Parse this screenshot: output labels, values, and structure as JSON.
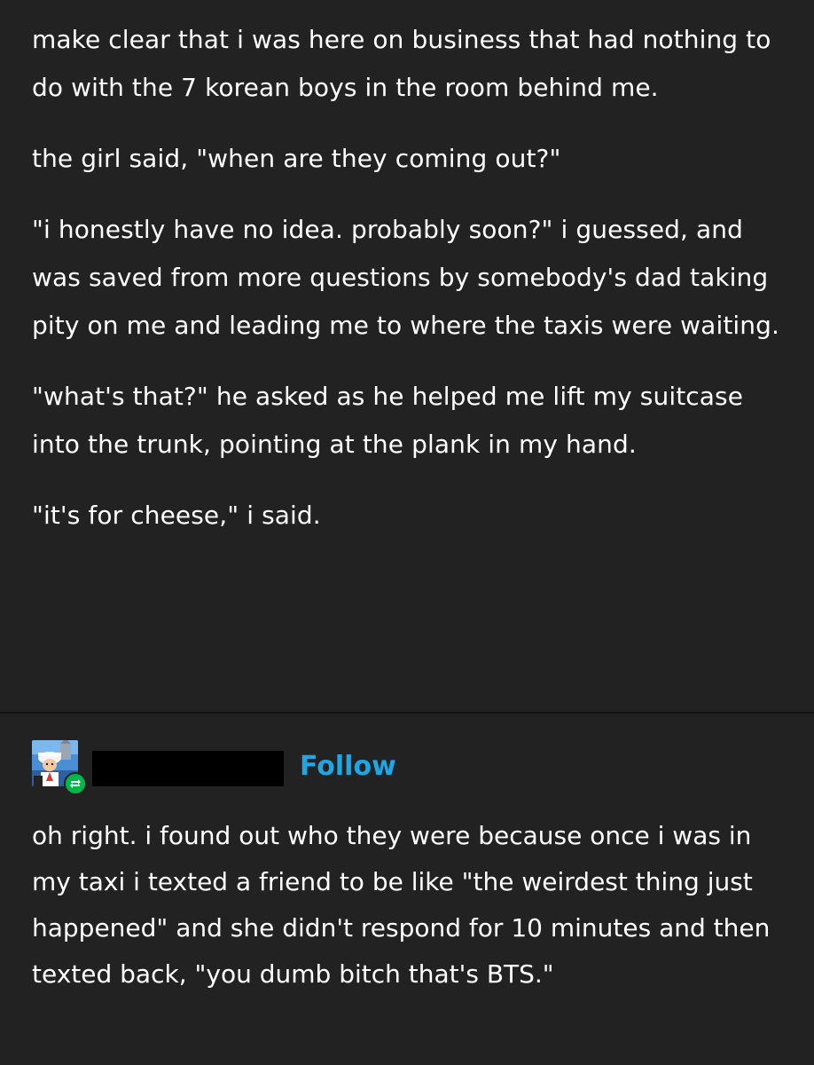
{
  "post": {
    "paragraphs": [
      "make clear that i was here on business that had nothing to do with the 7 korean boys in the room behind me.",
      "the girl said, \"when are they coming out?\"",
      "\"i honestly have no idea. probably soon?\" i guessed, and was saved from more questions by somebody's dad taking pity on me and leading me to where the taxis were waiting.",
      "\"what's that?\" he asked as he helped me lift my suitcase into the trunk, pointing at the plank in my hand.",
      "\"it's for cheese,\" i said."
    ]
  },
  "reblog": {
    "follow_label": "Follow",
    "avatar_icon": "cartoon-avatar-icon",
    "reblog_icon": "reblog-icon",
    "accent_color": "#1ea7e6",
    "reblog_color": "#00b84a",
    "text": "oh right. i found out who they were because once i was in my taxi i texted a friend to be like \"the weirdest thing just happened\" and she didn't respond for 10 minutes and then texted back, \"you dumb bitch that's BTS.\""
  }
}
